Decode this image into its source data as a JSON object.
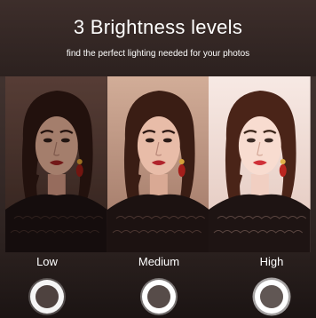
{
  "header": {
    "title": "3 Brightness levels",
    "subtitle": "find the perfect lighting needed for your photos"
  },
  "levels": [
    {
      "label": "Low",
      "glow": 0.55
    },
    {
      "label": "Medium",
      "glow": 0.78
    },
    {
      "label": "High",
      "glow": 1.0
    }
  ],
  "colors": {
    "background": "#2f2422",
    "text": "#ffffff",
    "panel_low": "#5a4038",
    "panel_medium": "#c09a84",
    "panel_high": "#f1ddd6"
  }
}
